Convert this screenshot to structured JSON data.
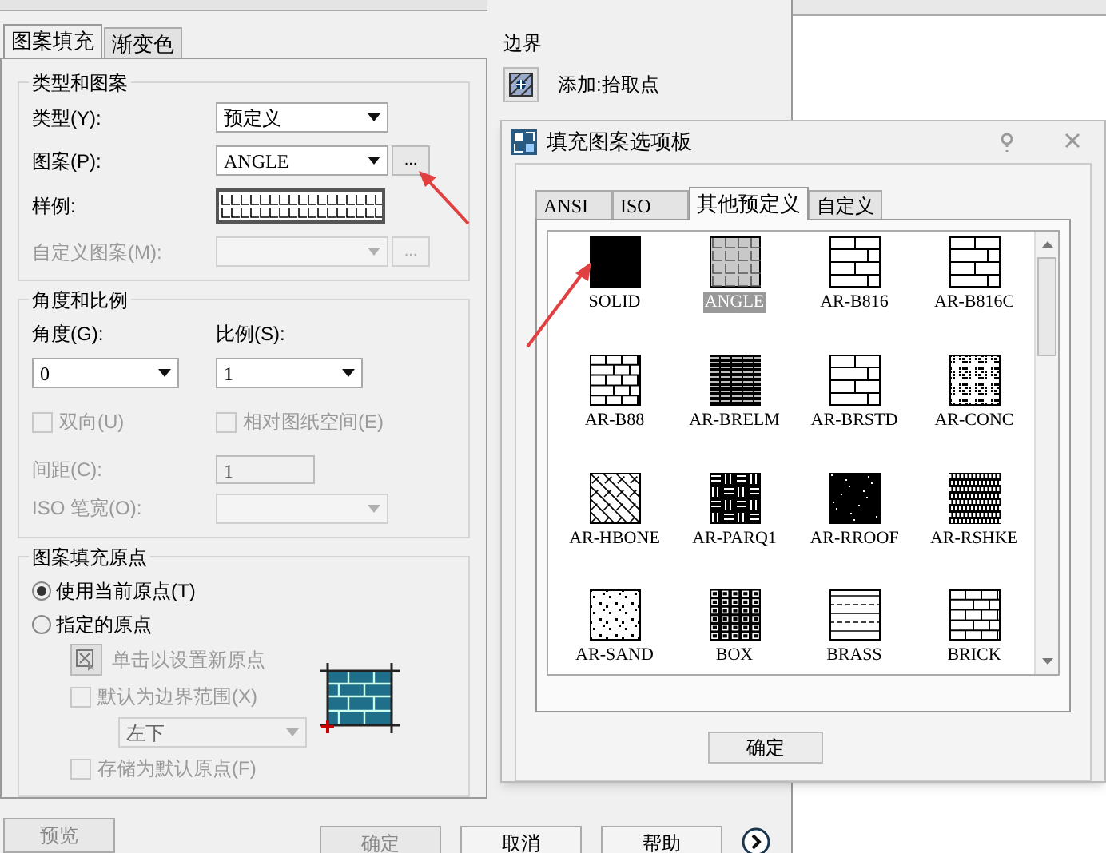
{
  "tabs": [
    {
      "label": "图案填充",
      "selected": true
    },
    {
      "label": "渐变色",
      "selected": false
    }
  ],
  "type_pattern": {
    "title": "类型和图案",
    "type": {
      "label": "类型(Y):",
      "value": "预定义"
    },
    "pattern": {
      "label": "图案(P):",
      "value": "ANGLE",
      "browse": "..."
    },
    "sample": {
      "label": "样例:"
    },
    "custom": {
      "label": "自定义图案(M):",
      "disabled": true,
      "browse": "..."
    }
  },
  "angle_scale": {
    "title": "角度和比例",
    "angle": {
      "label": "角度(G):",
      "value": "0"
    },
    "scale": {
      "label": "比例(S):",
      "value": "1"
    },
    "checkboxes": [
      {
        "label": "双向(U)",
        "checked": false,
        "disabled": true
      },
      {
        "label": "相对图纸空间(E)",
        "checked": false,
        "disabled": true
      }
    ],
    "spacing": {
      "label": "间距(C):",
      "value": "1",
      "disabled": true
    },
    "iso_pen": {
      "label": "ISO 笔宽(O):",
      "disabled": true
    }
  },
  "origin": {
    "title": "图案填充原点",
    "radios": [
      {
        "label": "使用当前原点(T)",
        "selected": true
      },
      {
        "label": "指定的原点",
        "selected": false
      }
    ],
    "set_origin": "单击以设置新原点",
    "default_extent": {
      "label": "默认为边界范围(X)",
      "checked": false,
      "disabled": true
    },
    "position": "左下",
    "store": {
      "label": "存储为默认原点(F)",
      "checked": false,
      "disabled": true
    }
  },
  "bottom_buttons": [
    "预览",
    "确定",
    "取消",
    "帮助"
  ],
  "boundary": {
    "title": "边界",
    "add_pick": "添加:拾取点"
  },
  "palette": {
    "title": "填充图案选项板",
    "tabs": [
      {
        "label": "ANSI",
        "selected": false
      },
      {
        "label": "ISO",
        "selected": false
      },
      {
        "label": "其他预定义",
        "selected": true
      },
      {
        "label": "自定义",
        "selected": false
      }
    ],
    "patterns": [
      {
        "name": "SOLID",
        "kind": "solid",
        "selected": false
      },
      {
        "name": "ANGLE",
        "kind": "angle",
        "selected": true
      },
      {
        "name": "AR-B816",
        "kind": "brick",
        "selected": false
      },
      {
        "name": "AR-B816C",
        "kind": "brick",
        "selected": false
      },
      {
        "name": "AR-B88",
        "kind": "brick_small",
        "selected": false
      },
      {
        "name": "AR-BRELM",
        "kind": "dark_lines",
        "selected": false
      },
      {
        "name": "AR-BRSTD",
        "kind": "brick",
        "selected": false
      },
      {
        "name": "AR-CONC",
        "kind": "noise",
        "selected": false
      },
      {
        "name": "AR-HBONE",
        "kind": "herringbone",
        "selected": false
      },
      {
        "name": "AR-PARQ1",
        "kind": "parquet",
        "selected": false
      },
      {
        "name": "AR-RROOF",
        "kind": "dark_dots",
        "selected": false
      },
      {
        "name": "AR-RSHKE",
        "kind": "shake",
        "selected": false
      },
      {
        "name": "AR-SAND",
        "kind": "sand",
        "selected": false
      },
      {
        "name": "BOX",
        "kind": "box",
        "selected": false
      },
      {
        "name": "BRASS",
        "kind": "dashes",
        "selected": false
      },
      {
        "name": "BRICK",
        "kind": "brick_small",
        "selected": false
      }
    ],
    "ok": "确定"
  }
}
